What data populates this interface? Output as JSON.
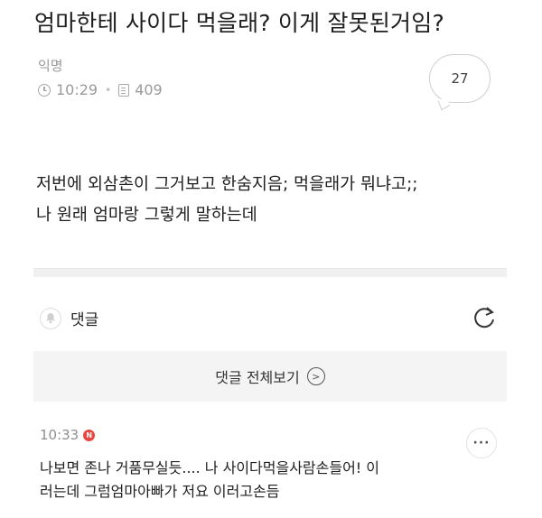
{
  "post": {
    "title": "엄마한테 사이다 먹을래? 이게 잘못된거임?",
    "author": "익명",
    "time": "10:29",
    "views": "409",
    "comment_count": "27",
    "body_lines": [
      "저번에 외삼촌이 그거보고 한숨지음; 먹을래가 뭐냐고;;",
      "나 원래 엄마랑 그렇게 말하는데"
    ]
  },
  "comments": {
    "label": "댓글",
    "view_all_label": "댓글 전체보기",
    "items": [
      {
        "time": "10:33",
        "badge": "N",
        "lines": [
          "나보면 존나 거품무실듯.... 나 사이다먹을사람손들어! 이",
          "러는데 그럼엄마아빠가 저요 이러고손듬"
        ]
      }
    ]
  },
  "icons": {
    "clock": "clock-icon",
    "views": "document-icon",
    "bell": "bell-icon",
    "refresh": "refresh-icon",
    "more": "more-icon",
    "chevron": "chevron-right-icon"
  },
  "colors": {
    "new_badge": "#e8473f",
    "meta_text": "#9a9a9a",
    "view_all_bg": "#f4f4f4"
  }
}
